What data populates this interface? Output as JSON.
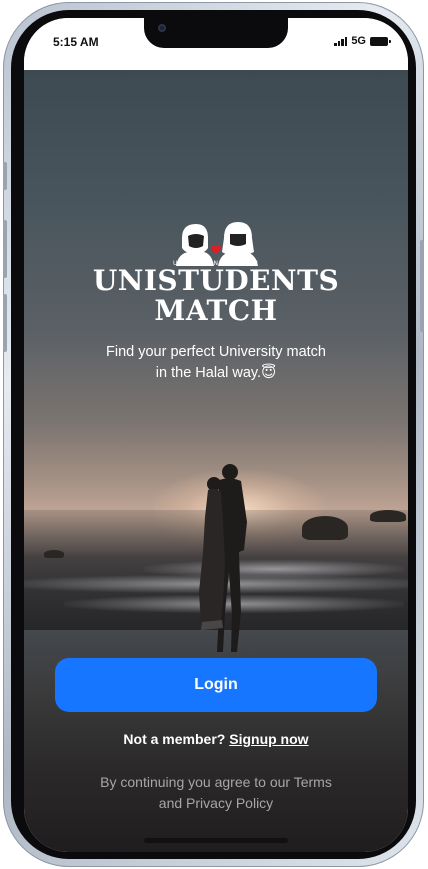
{
  "status_bar": {
    "time": "5:15 AM",
    "network": "5G",
    "icons": [
      "signal-icon",
      "battery-icon"
    ]
  },
  "logo": {
    "icon": "couple-logo-icon",
    "small_text": "UNISTUDENTS MATCH",
    "heart_color": "#e31b23"
  },
  "brand": {
    "line1": "UNISTUDENTS",
    "line2": "MATCH"
  },
  "tagline": {
    "line1": "Find your perfect University match",
    "line2": "in the Halal way.",
    "emoji": "😇"
  },
  "login": {
    "label": "Login",
    "color": "#1676ff"
  },
  "signup": {
    "prompt": "Not a member?",
    "link": "Signup now"
  },
  "terms": {
    "line1": "By continuing you agree to our Terms",
    "line2": "and Privacy Policy"
  }
}
